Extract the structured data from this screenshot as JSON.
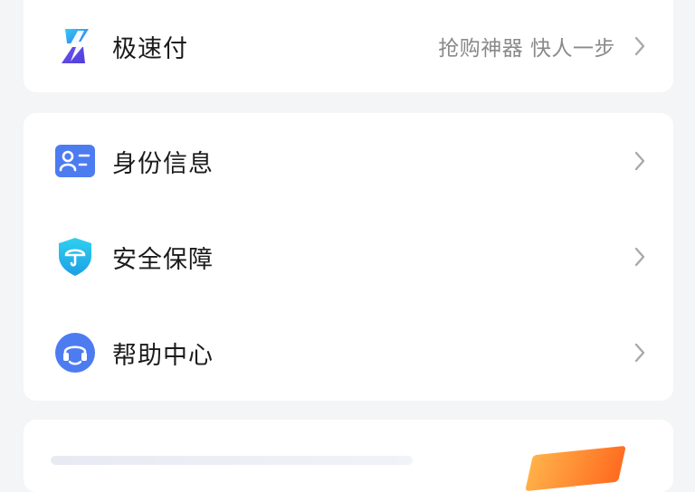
{
  "colors": {
    "page_bg": "#f4f5f7",
    "card_bg": "#ffffff",
    "label": "#1b1b1b",
    "hint": "#8a8a8a",
    "chevron": "#a9a9a9",
    "accent_blue": "#4d7cf1",
    "accent_cyan": "#27b7f2",
    "accent_orange": "#ff7a22"
  },
  "top_card": {
    "row": {
      "icon": "lightning-icon",
      "label": "极速付",
      "hint": "抢购神器 快人一步",
      "chevron": "chevron-right-icon"
    }
  },
  "menu_card": {
    "items": [
      {
        "icon": "id-card-icon",
        "label": "身份信息",
        "chevron": "chevron-right-icon"
      },
      {
        "icon": "shield-umbrella-icon",
        "label": "安全保障",
        "chevron": "chevron-right-icon"
      },
      {
        "icon": "headset-icon",
        "label": "帮助中心",
        "chevron": "chevron-right-icon"
      }
    ]
  }
}
